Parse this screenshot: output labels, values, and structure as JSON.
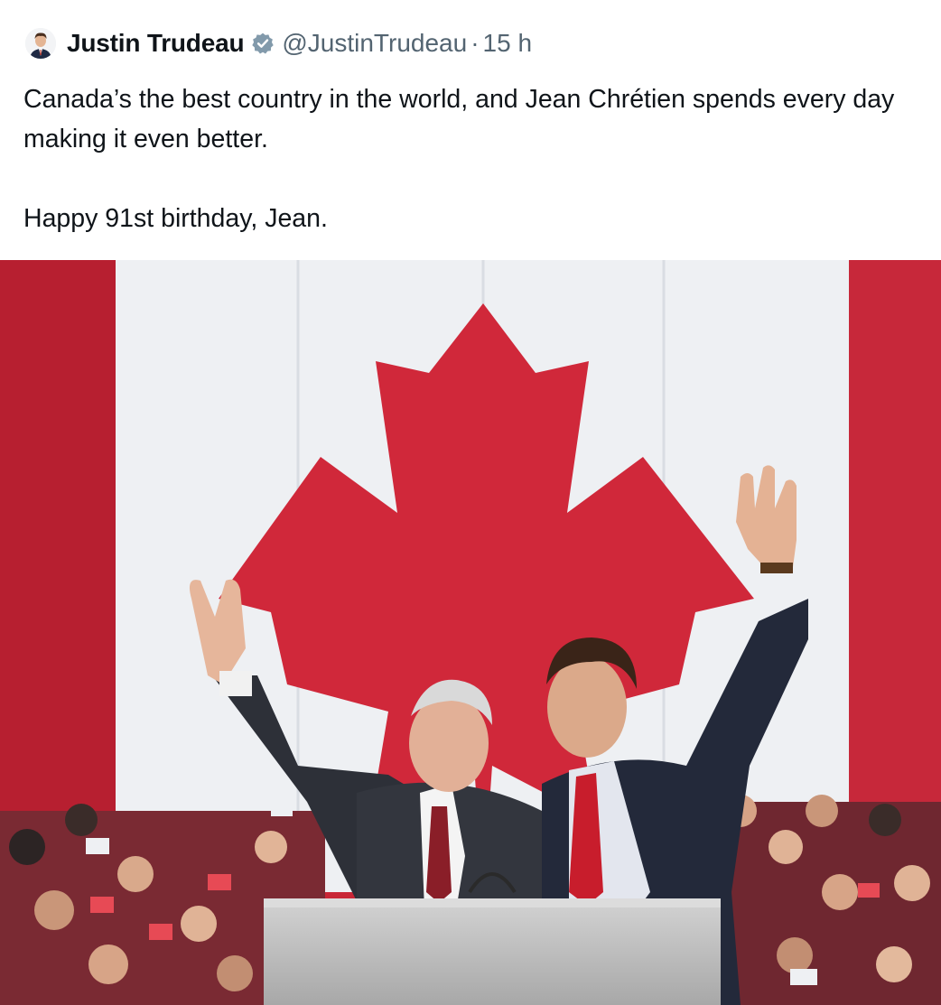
{
  "tweet": {
    "author": {
      "display_name": "Justin Trudeau",
      "handle": "@JustinTrudeau",
      "separator": "·",
      "time": "15 h",
      "verified_icon": "verified-badge-icon"
    },
    "text_line1": "Canada’s the best country in the world, and Jean Chrétien spends every day making it even better.",
    "text_line2": "Happy 91st birthday, Jean.",
    "media": {
      "type": "photo",
      "colors": {
        "flag_red": "#d0283a",
        "flag_white": "#eef0f3",
        "suit_dark": "#2b2e36",
        "podium": "#c9c9c9"
      }
    }
  }
}
